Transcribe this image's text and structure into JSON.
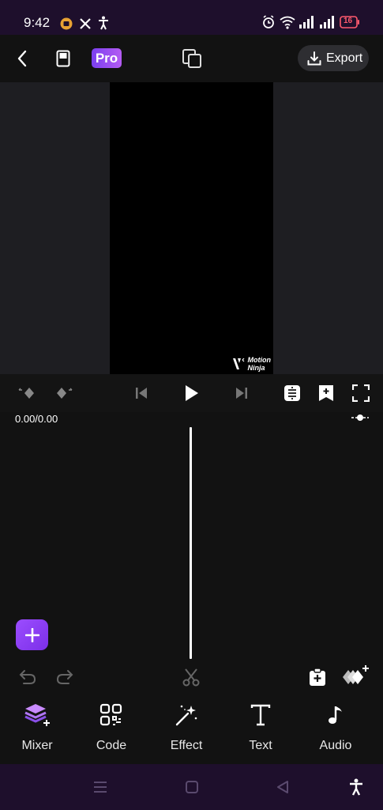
{
  "status_bar": {
    "time": "9:42",
    "battery": "16"
  },
  "top_bar": {
    "pro_label": "Pro",
    "export_label": "Export"
  },
  "preview": {
    "watermark_line1": "Motion",
    "watermark_line2": "Ninja"
  },
  "playback": {
    "time_readout": "0.00/0.00"
  },
  "tools": [
    {
      "label": "Mixer",
      "icon": "layers-icon"
    },
    {
      "label": "Code",
      "icon": "qr-code-icon"
    },
    {
      "label": "Effect",
      "icon": "magic-wand-icon"
    },
    {
      "label": "Text",
      "icon": "text-icon"
    },
    {
      "label": "Audio",
      "icon": "music-note-icon"
    }
  ],
  "colors": {
    "accent": "#8e44f5",
    "status_bar_bg": "#1e0f2c",
    "background": "#121212"
  }
}
